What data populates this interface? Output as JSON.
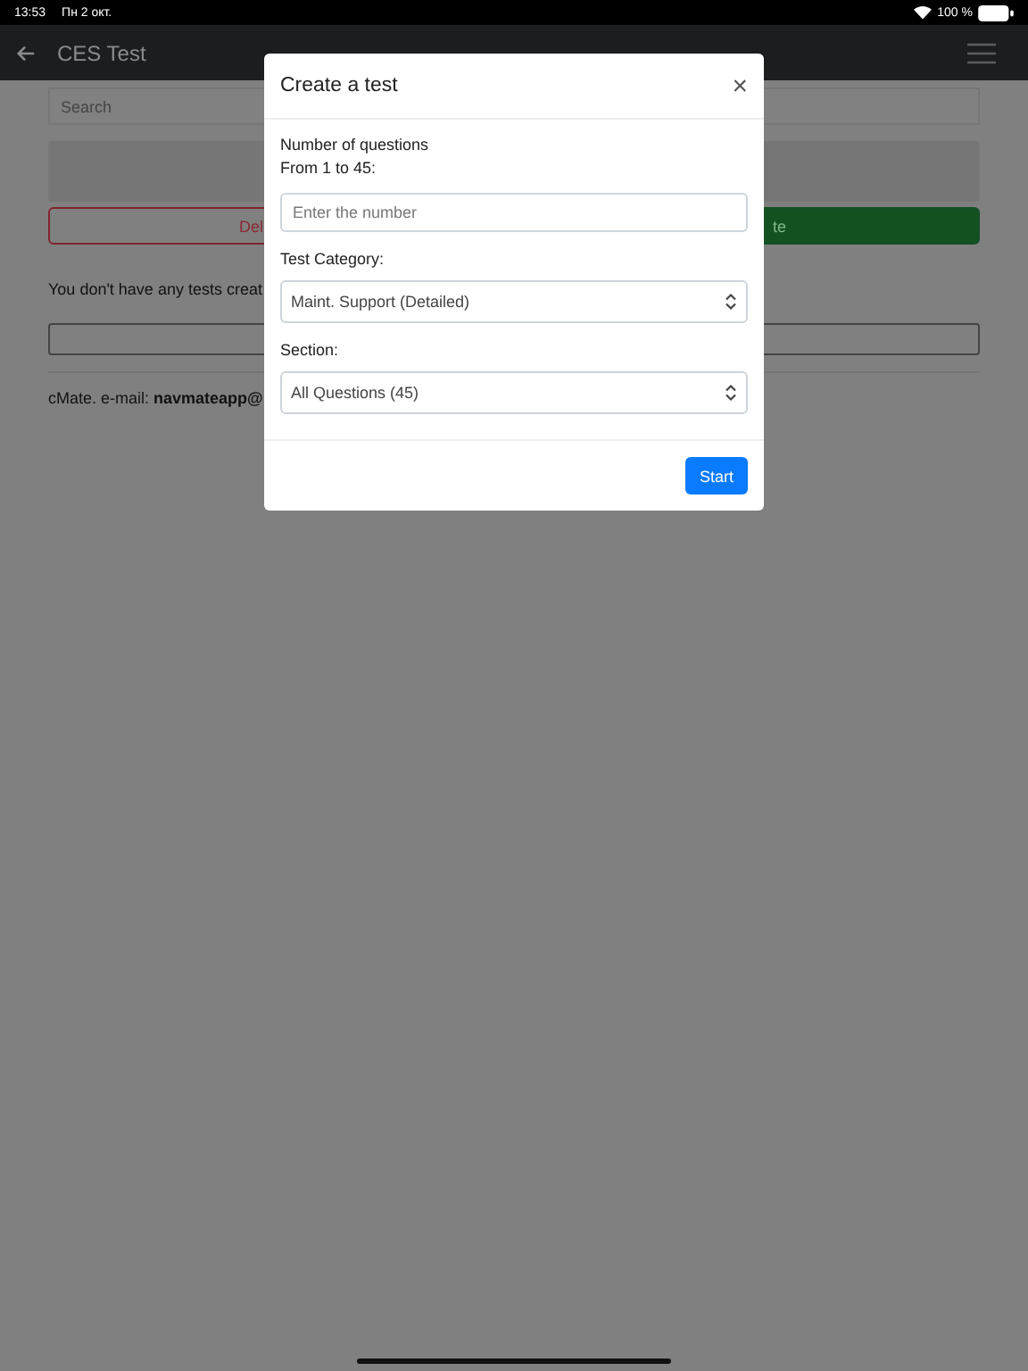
{
  "status_bar": {
    "time": "13:53",
    "date": "Пн 2 окт.",
    "battery": "100 %"
  },
  "nav": {
    "title": "CES Test"
  },
  "page": {
    "search": {
      "placeholder": "Search"
    },
    "delete_button": "Del",
    "create_button": "te",
    "empty_message": "You don't have any tests creat",
    "footer": "cMate. e-mail: **navmateapp@**"
  },
  "dialog": {
    "title": "Create a test",
    "close": "×",
    "fields": [
      {
        "kind": "input",
        "label_lines": [
          "Number of questions",
          "From 1 to 45:"
        ],
        "placeholder": "Enter the number"
      },
      {
        "kind": "select",
        "label_lines": [
          "Test Category:"
        ],
        "value": "Maint. Support (Detailed)"
      },
      {
        "kind": "select",
        "label_lines": [
          "Section:"
        ],
        "value": "All Questions (45)"
      }
    ],
    "start_button": "Start"
  }
}
